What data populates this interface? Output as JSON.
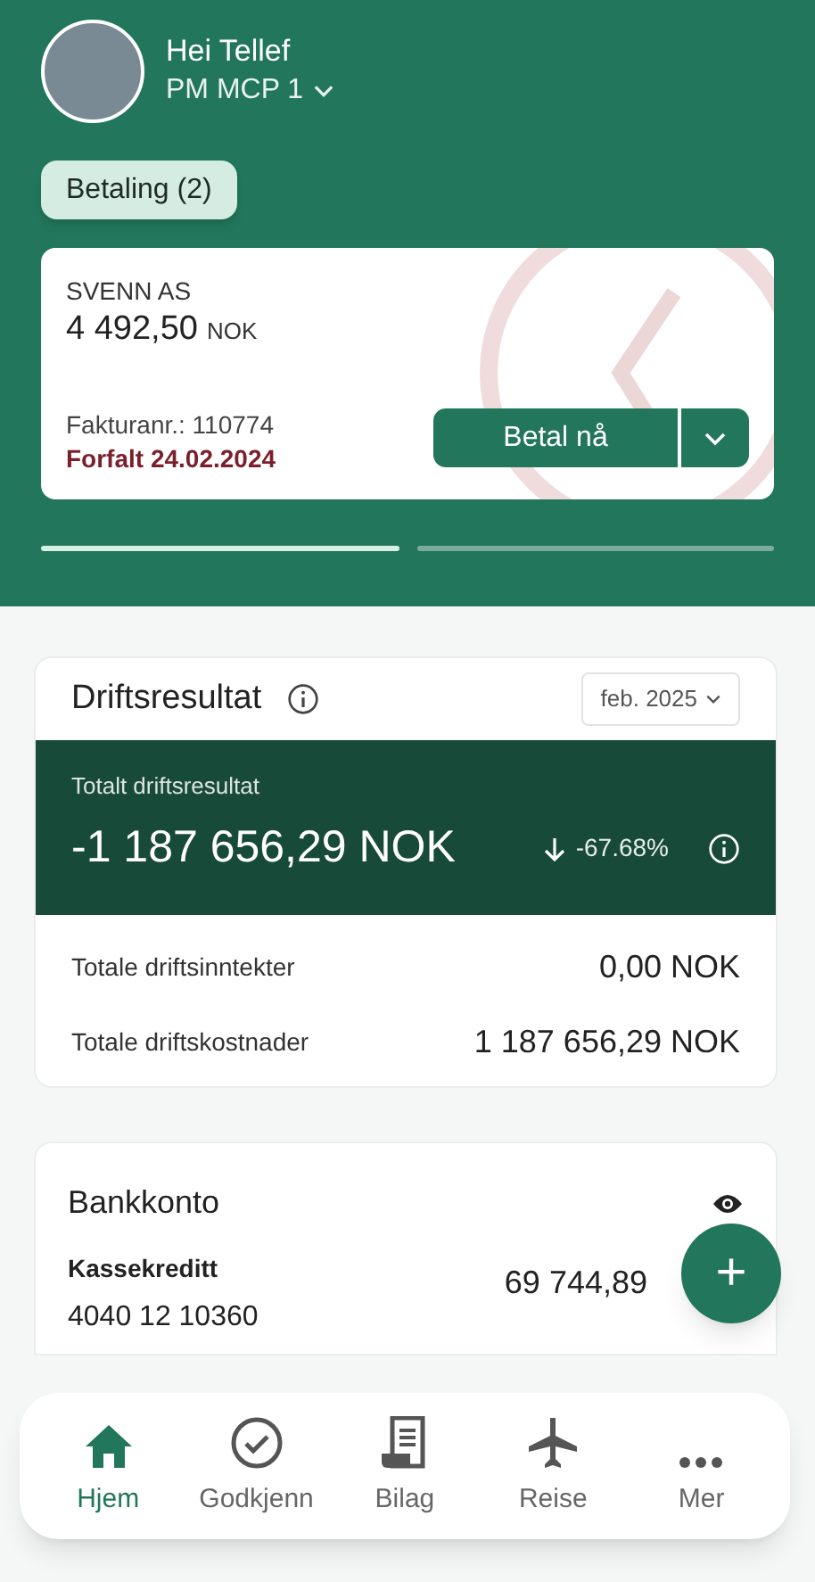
{
  "header": {
    "greeting": "Hei Tellef",
    "company": "PM MCP 1"
  },
  "chips": [
    {
      "label": "Betaling (2)",
      "selected": true
    }
  ],
  "payment_card": {
    "payee": "SVENN AS",
    "amount": "4 492,50",
    "currency": "NOK",
    "invoice_no": "Fakturanr.: 110774",
    "due": "Forfalt 24.02.2024",
    "pay_button": "Betal nå"
  },
  "carousel_pages": [
    {
      "selected": true
    },
    {
      "selected": false
    }
  ],
  "operating_result": {
    "title": "Driftsresultat",
    "period": "feb. 2025",
    "total_label": "Totalt driftsresultat",
    "total": "-1 187 656,29 NOK",
    "change": "-67.68%",
    "rows": [
      {
        "label": "Totale driftsinntekter",
        "value": "0,00 NOK"
      },
      {
        "label": "Totale driftskostnader",
        "value": "1 187 656,29 NOK"
      }
    ]
  },
  "bank_account": {
    "title": "Bankkonto",
    "account_name": "Kassekreditt",
    "account_number": "4040 12 10360",
    "balance": "69 744,89"
  },
  "fab": {
    "symbol": "+"
  },
  "nav": [
    {
      "label": "Hjem",
      "kind": "home",
      "selected": true
    },
    {
      "label": "Godkjenn",
      "kind": "check",
      "selected": false
    },
    {
      "label": "Bilag",
      "kind": "receipt",
      "selected": false
    },
    {
      "label": "Reise",
      "kind": "plane",
      "selected": false
    },
    {
      "label": "Mer",
      "kind": "more",
      "selected": false
    }
  ]
}
